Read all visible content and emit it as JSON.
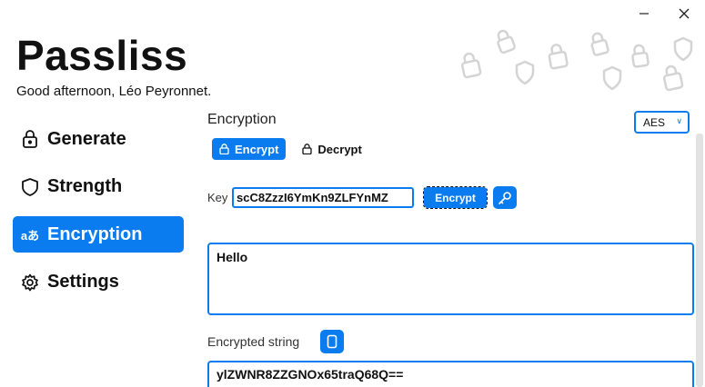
{
  "window": {
    "minimize_icon": "minimize-icon",
    "close_icon": "close-icon"
  },
  "app": {
    "title": "Passliss",
    "greeting": "Good afternoon, Léo Peyronnet."
  },
  "nav": {
    "items": [
      {
        "label": "Generate",
        "icon": "lock-icon"
      },
      {
        "label": "Strength",
        "icon": "shield-icon"
      },
      {
        "label": "Encryption",
        "icon": "translate-icon",
        "active": true
      },
      {
        "label": "Settings",
        "icon": "gear-icon"
      }
    ]
  },
  "encryption": {
    "section_title": "Encryption",
    "algorithm": "AES",
    "tabs": [
      {
        "label": "Encrypt",
        "icon": "lock-icon",
        "active": true
      },
      {
        "label": "Decrypt",
        "icon": "lock-icon"
      }
    ],
    "key_label": "Key",
    "key_value": "scC8ZzzI6YmKn9ZLFYnMZ",
    "encrypt_button": "Encrypt",
    "input_text": "Hello",
    "output_label": "Encrypted string",
    "output_value": "ylZWNR8ZZGNOx65traQ68Q=="
  },
  "colors": {
    "accent": "#0a7cf0",
    "background": "#ffffff"
  }
}
